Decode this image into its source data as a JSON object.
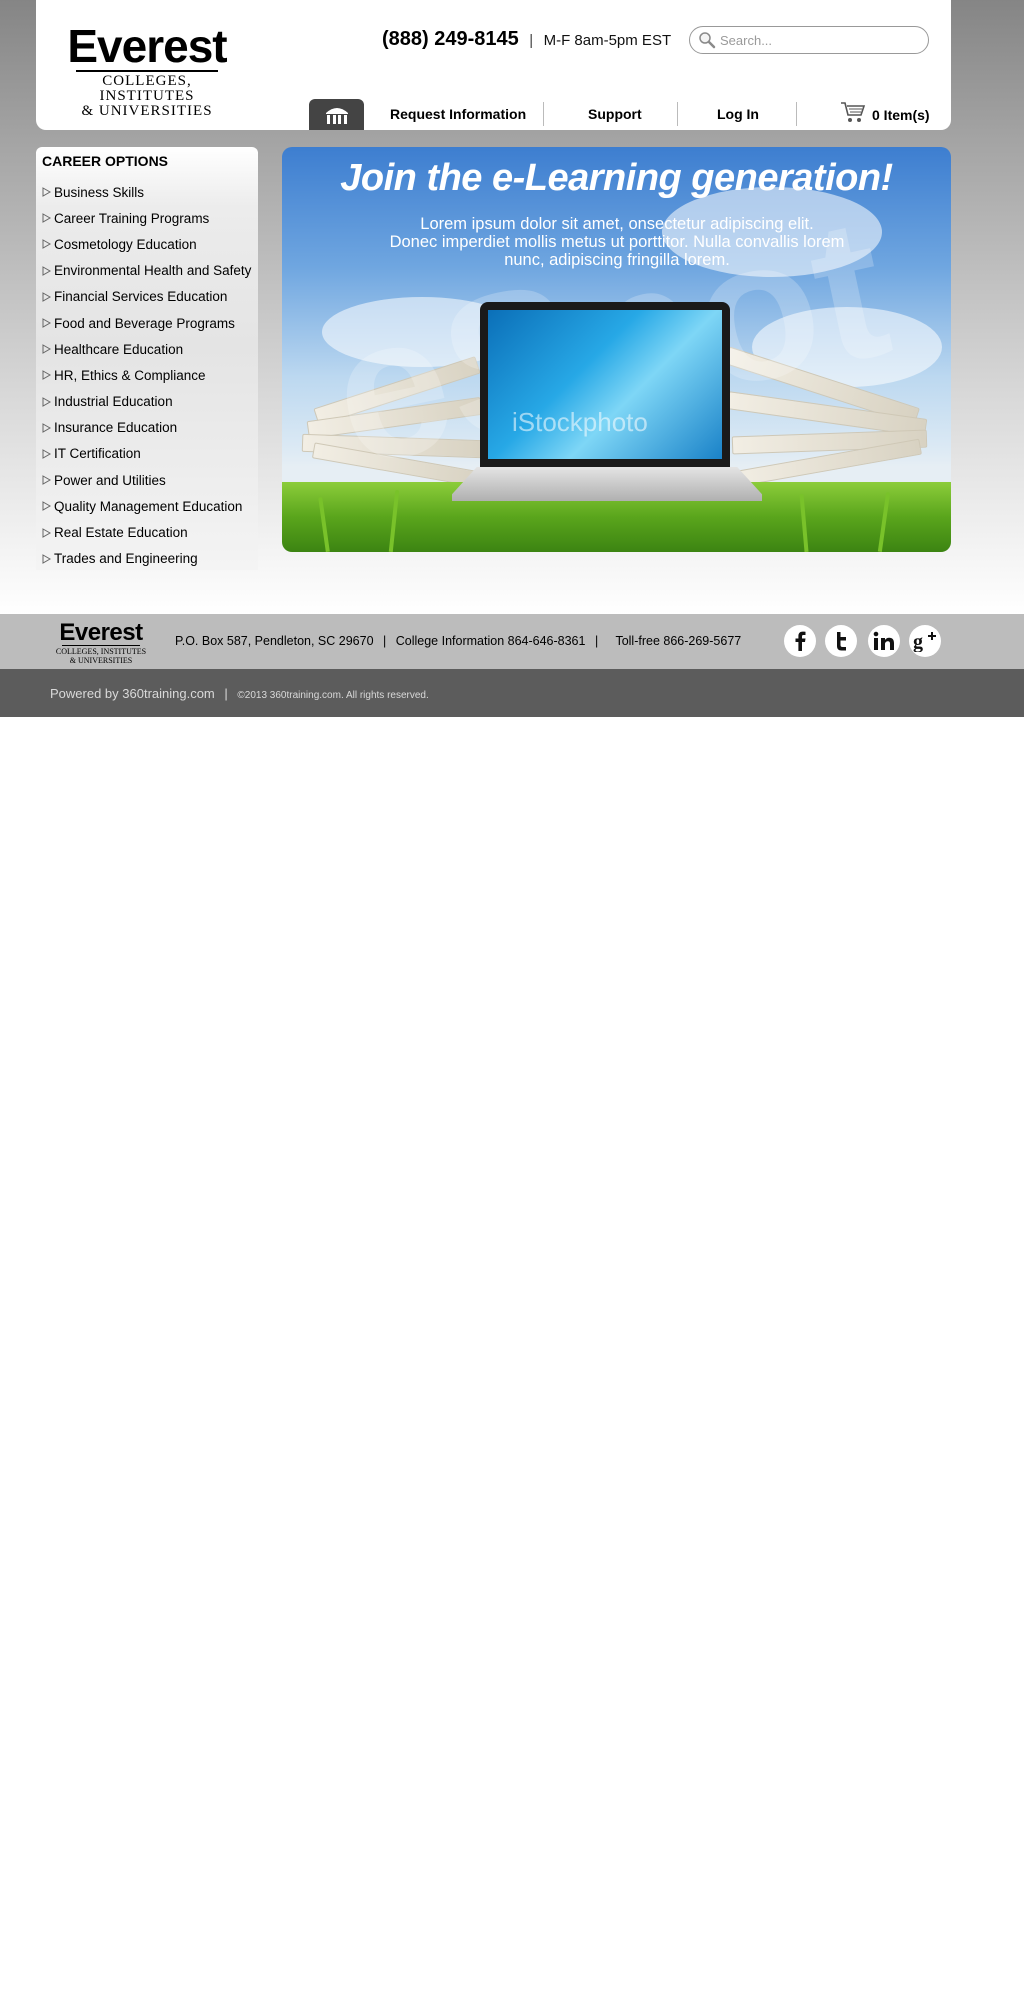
{
  "header": {
    "logo": {
      "word": "Everest",
      "sub_line1": "COLLEGES, INSTITUTES",
      "sub_line2": "& UNIVERSITIES"
    },
    "phone": "(888) 249-8145",
    "separator": "|",
    "hours": "M-F 8am-5pm EST",
    "search": {
      "placeholder": "Search..."
    },
    "nav": {
      "home_icon": "storefront-icon",
      "items": [
        "Request Information",
        "Support",
        "Log In"
      ]
    },
    "cart": {
      "icon": "cart-icon",
      "label": "0 Item(s)"
    }
  },
  "sidebar": {
    "title": "CAREER OPTIONS",
    "items": [
      "Business Skills",
      "Career Training Programs",
      "Cosmetology Education",
      "Environmental Health and Safety",
      "Financial Services Education",
      "Food and Beverage Programs",
      "Healthcare Education",
      "HR, Ethics & Compliance",
      "Industrial Education",
      "Insurance Education",
      "IT Certification",
      "Power and Utilities",
      "Quality Management Education",
      "Real Estate Education",
      "Trades and Engineering"
    ]
  },
  "banner": {
    "title": "Join the e-Learning generation!",
    "text_line1": "Lorem ipsum dolor sit amet, onsectetur adipiscing elit.",
    "text_line2": "Donec imperdiet mollis metus ut porttitor. Nulla convallis lorem",
    "text_line3": "nunc, adipiscing fringilla lorem.",
    "watermark": "iStockphoto",
    "watermark_big": "eSpot"
  },
  "footer": {
    "logo": {
      "word": "Everest",
      "sub_line1": "COLLEGES, INSTITUTES",
      "sub_line2": "& UNIVERSITIES"
    },
    "address": "P.O. Box 587, Pendleton, SC 29670",
    "college_info": "College Information 864-646-8361",
    "tollfree": "Toll-free 866-269-5677",
    "separator": "|",
    "social": [
      "facebook-icon",
      "twitter-icon",
      "linkedin-icon",
      "google-plus-icon"
    ],
    "powered": "Powered by 360training.com",
    "copyright": "©2013 360training.com. All rights reserved."
  },
  "colors": {
    "nav_home_bg": "#444444",
    "footer_main_bg": "#bcbcbc",
    "footer_bottom_bg": "#5c5c5c"
  }
}
